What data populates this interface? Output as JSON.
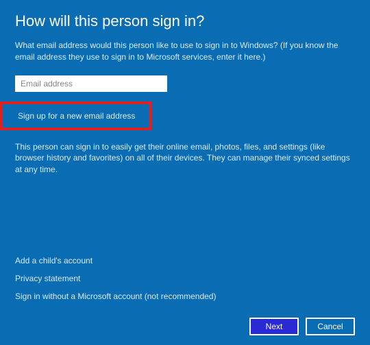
{
  "title": "How will this person sign in?",
  "description": "What email address would this person like to use to sign in to Windows? (If you know the email address they use to sign in to Microsoft services, enter it here.)",
  "email": {
    "placeholder": "Email address",
    "value": ""
  },
  "signup_link": "Sign up for a new email address",
  "info": "This person can sign in to easily get their online email, photos, files, and settings (like browser history and favorites) on all of their devices. They can manage their synced settings at any time.",
  "links": {
    "add_child": "Add a child's account",
    "privacy": "Privacy statement",
    "sign_in_local": "Sign in without a Microsoft account (not recommended)"
  },
  "buttons": {
    "next": "Next",
    "cancel": "Cancel"
  }
}
